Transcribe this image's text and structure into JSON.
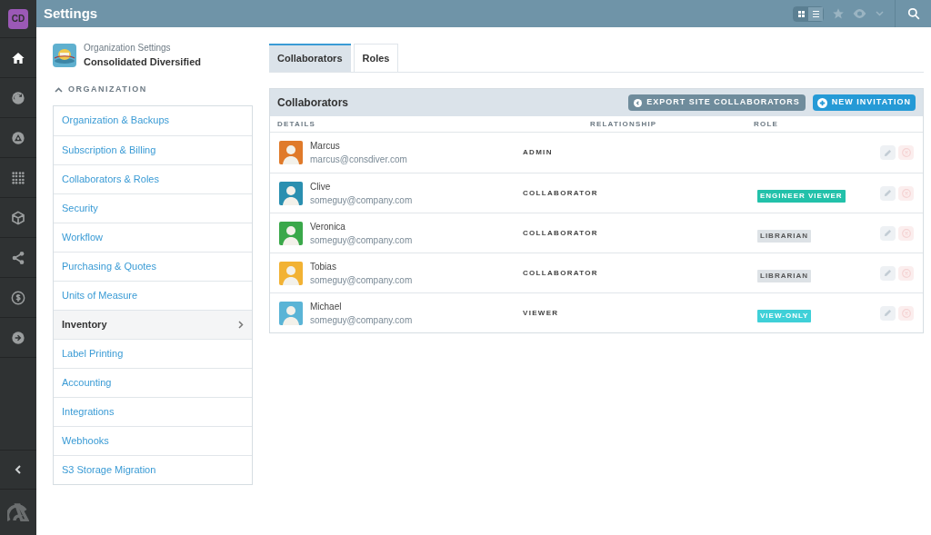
{
  "app_badge": "CD",
  "rail": [
    {
      "kind": "home",
      "selected": true
    },
    {
      "kind": "sync",
      "selected": false
    },
    {
      "kind": "triangle",
      "selected": false
    },
    {
      "kind": "dots",
      "selected": false
    },
    {
      "kind": "cube",
      "selected": false
    },
    {
      "kind": "share",
      "selected": false
    },
    {
      "kind": "dollar",
      "selected": false
    },
    {
      "kind": "arrow",
      "selected": false
    }
  ],
  "header": {
    "title": "Settings",
    "view_toggle": [
      {
        "kind": "grid",
        "selected": true
      },
      {
        "kind": "list",
        "selected": false
      }
    ]
  },
  "org": {
    "caption": "Organization Settings",
    "name": "Consolidated Diversified"
  },
  "section": {
    "label": "ORGANIZATION",
    "expanded": true
  },
  "menu": [
    {
      "label": "Organization & Backups",
      "selected": false
    },
    {
      "label": "Subscription & Billing",
      "selected": false
    },
    {
      "label": "Collaborators & Roles",
      "selected": false
    },
    {
      "label": "Security",
      "selected": false
    },
    {
      "label": "Workflow",
      "selected": false
    },
    {
      "label": "Purchasing & Quotes",
      "selected": false
    },
    {
      "label": "Units of Measure",
      "selected": false
    },
    {
      "label": "Inventory",
      "selected": true
    },
    {
      "label": "Label Printing",
      "selected": false
    },
    {
      "label": "Accounting",
      "selected": false
    },
    {
      "label": "Integrations",
      "selected": false
    },
    {
      "label": "Webhooks",
      "selected": false
    },
    {
      "label": "S3 Storage Migration",
      "selected": false
    }
  ],
  "tabs": [
    {
      "label": "Collaborators",
      "selected": true
    },
    {
      "label": "Roles",
      "selected": false
    }
  ],
  "panel": {
    "title": "Collaborators",
    "export_button": "EXPORT SITE COLLABORATORS",
    "invite_button": "NEW INVITATION",
    "columns": [
      "DETAILS",
      "RELATIONSHIP",
      "ROLE"
    ],
    "rows": [
      {
        "name": "Marcus",
        "email": "marcus@consdiver.com",
        "relationship": "ADMIN",
        "color": "#e07a2a"
      },
      {
        "name": "Clive",
        "email": "someguy@company.com",
        "relationship": "COLLABORATOR",
        "color": "#2a8fb0",
        "role": {
          "label": "ENGINEER VIEWER",
          "color": "#22c1aa"
        }
      },
      {
        "name": "Veronica",
        "email": "someguy@company.com",
        "relationship": "COLLABORATOR",
        "color": "#3aa84a",
        "role": {
          "label": "LIBRARIAN",
          "color": "#dde2e6"
        }
      },
      {
        "name": "Tobias",
        "email": "someguy@company.com",
        "relationship": "COLLABORATOR",
        "color": "#f2b233",
        "role": {
          "label": "LIBRARIAN",
          "color": "#dde2e6"
        }
      },
      {
        "name": "Michael",
        "email": "someguy@company.com",
        "relationship": "VIEWER",
        "color": "#5ab4d6",
        "role": {
          "label": "VIEW-ONLY",
          "color": "#3fd0d8"
        }
      }
    ]
  }
}
